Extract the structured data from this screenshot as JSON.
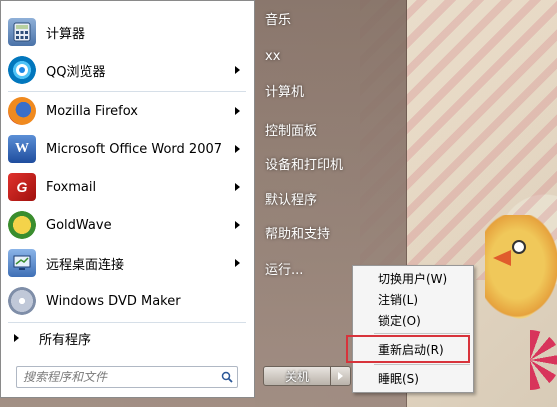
{
  "programs": [
    {
      "label": "计算器",
      "has_submenu": false,
      "icon": "calculator-icon"
    },
    {
      "label": "QQ浏览器",
      "has_submenu": true,
      "icon": "qq-browser-icon"
    },
    {
      "label": "Mozilla Firefox",
      "has_submenu": true,
      "icon": "firefox-icon"
    },
    {
      "label": "Microsoft Office Word 2007",
      "has_submenu": true,
      "icon": "word-icon"
    },
    {
      "label": "Foxmail",
      "has_submenu": true,
      "icon": "foxmail-icon"
    },
    {
      "label": "GoldWave",
      "has_submenu": true,
      "icon": "goldwave-icon"
    },
    {
      "label": "远程桌面连接",
      "has_submenu": true,
      "icon": "remote-desktop-icon"
    },
    {
      "label": "Windows DVD Maker",
      "has_submenu": false,
      "icon": "dvd-maker-icon"
    }
  ],
  "all_programs_label": "所有程序",
  "search": {
    "placeholder": "搜索程序和文件"
  },
  "right_items": [
    {
      "label": "音乐"
    },
    {
      "label": "xx"
    },
    {
      "label": "计算机"
    },
    {
      "label": "控制面板"
    },
    {
      "label": "设备和打印机"
    },
    {
      "label": "默认程序"
    },
    {
      "label": "帮助和支持"
    },
    {
      "label": "运行..."
    }
  ],
  "shutdown": {
    "label": "关机"
  },
  "submenu": {
    "items": [
      {
        "label": "切换用户(W)"
      },
      {
        "label": "注销(L)"
      },
      {
        "label": "锁定(O)"
      },
      {
        "label": "重新启动(R)"
      },
      {
        "label": "睡眠(S)"
      }
    ]
  },
  "colors": {
    "highlight": "#d8333b"
  }
}
